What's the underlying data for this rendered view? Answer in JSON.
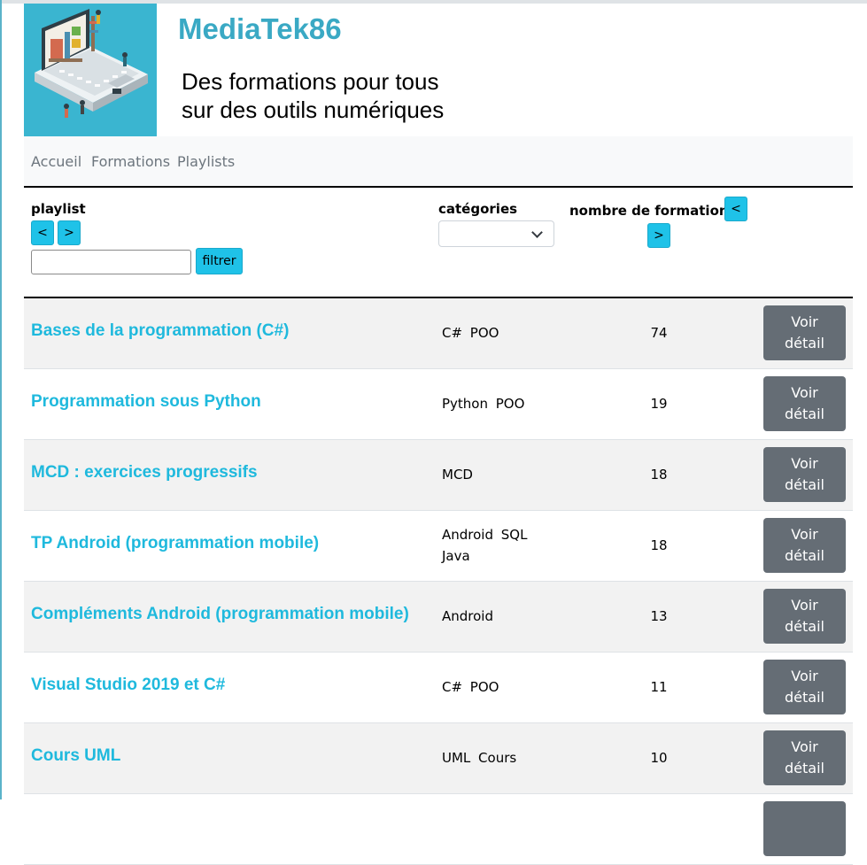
{
  "site": {
    "title": "MediaTek86",
    "tagline_line1": "Des formations pour tous",
    "tagline_line2": "sur des outils numériques"
  },
  "nav": {
    "items": [
      {
        "label": "Accueil"
      },
      {
        "label": "Formations"
      },
      {
        "label": "Playlists"
      }
    ]
  },
  "table_header": {
    "playlist_label": "playlist",
    "sort_asc": "<",
    "sort_desc": ">",
    "filter_input_value": "",
    "filter_button": "filtrer",
    "categories_label": "catégories",
    "categories_selected": "",
    "count_label": "nombre de formations"
  },
  "rows": [
    {
      "title": "Bases de la programmation (C#)",
      "categories": "C# POO",
      "count": "74",
      "action": "Voir détail"
    },
    {
      "title": "Programmation sous Python",
      "categories": "Python POO",
      "count": "19",
      "action": "Voir détail"
    },
    {
      "title": "MCD : exercices progressifs",
      "categories": "MCD",
      "count": "18",
      "action": "Voir détail"
    },
    {
      "title": "TP Android (programmation mobile)",
      "categories": "Android SQL Java",
      "count": "18",
      "action": "Voir détail"
    },
    {
      "title": "Compléments Android (programmation mobile)",
      "categories": "Android",
      "count": "13",
      "action": "Voir détail"
    },
    {
      "title": "Visual Studio 2019 et C#",
      "categories": "C# POO",
      "count": "11",
      "action": "Voir détail"
    },
    {
      "title": "Cours UML",
      "categories": "UML Cours",
      "count": "10",
      "action": "Voir détail"
    }
  ],
  "colors": {
    "brand": "#3aa9c4",
    "link": "#1fb9dd",
    "button_primary": "#1fc2e8",
    "button_secondary": "#656d75"
  }
}
